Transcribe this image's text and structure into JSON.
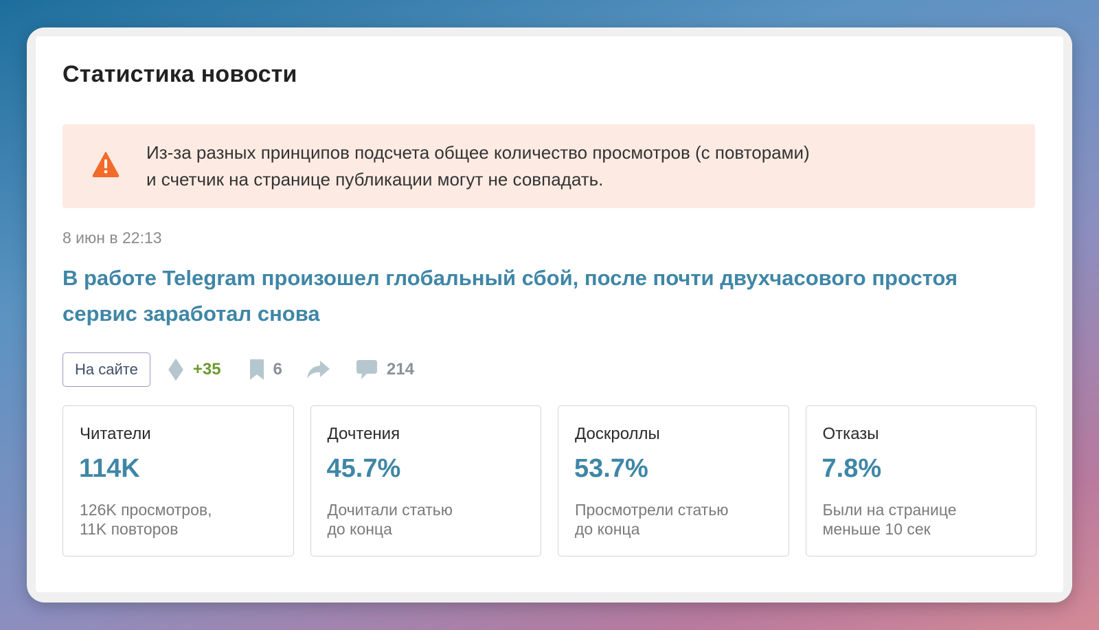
{
  "page": {
    "title": "Статистика новости"
  },
  "alert": {
    "line1": "Из-за разных принципов подсчета общее количество просмотров (с повторами)",
    "line2": "и счетчик на странице публикации могут не совпадать.",
    "icon": "warning-icon",
    "icon_color": "#f26b2a",
    "background": "#fdebe3"
  },
  "article": {
    "date": "8 июн в 22:13",
    "headline_line1": "В работе Telegram произошел глобальный сбой, после почти двухчасового простоя",
    "headline_line2": "сервис заработал снова",
    "link_color": "#3f86a6"
  },
  "actions": {
    "site_button": "На сайте",
    "karma": "+35",
    "karma_icon": "rating-diamond-icon",
    "bookmarks": "6",
    "bookmarks_icon": "bookmark-icon",
    "share_icon": "share-arrow-icon",
    "comments": "214",
    "comments_icon": "comment-bubble-icon"
  },
  "stats": [
    {
      "label": "Читатели",
      "value": "114K",
      "note_line1": "126K просмотров,",
      "note_line2": "11K повторов"
    },
    {
      "label": "Дочтения",
      "value": "45.7%",
      "note_line1": "Дочитали статью",
      "note_line2": "до конца"
    },
    {
      "label": "Доскроллы",
      "value": "53.7%",
      "note_line1": "Просмотрели статью",
      "note_line2": "до конца"
    },
    {
      "label": "Отказы",
      "value": "7.8%",
      "note_line1": "Были на странице",
      "note_line2": "меньше 10 сек"
    }
  ]
}
